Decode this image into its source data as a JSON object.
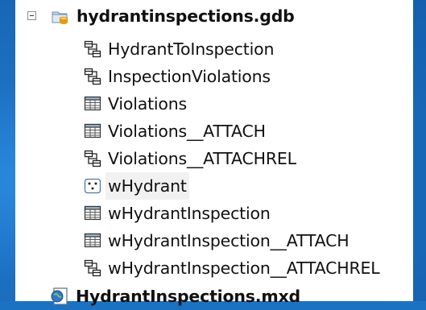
{
  "tree": {
    "geodatabase": {
      "label": "hydrantinspections.gdb",
      "icon": "geodatabase-icon",
      "expanded": true,
      "children": [
        {
          "label": "HydrantToInspection",
          "icon": "relationship-class-icon"
        },
        {
          "label": "InspectionViolations",
          "icon": "relationship-class-icon"
        },
        {
          "label": "Violations",
          "icon": "table-icon"
        },
        {
          "label": "Violations__ATTACH",
          "icon": "table-icon"
        },
        {
          "label": "Violations__ATTACHREL",
          "icon": "relationship-class-icon"
        },
        {
          "label": "wHydrant",
          "icon": "point-feature-class-icon",
          "selected": true
        },
        {
          "label": "wHydrantInspection",
          "icon": "table-icon"
        },
        {
          "label": "wHydrantInspection__ATTACH",
          "icon": "table-icon"
        },
        {
          "label": "wHydrantInspection__ATTACHREL",
          "icon": "relationship-class-icon"
        }
      ]
    },
    "map_document": {
      "label": "HydrantInspections.mxd",
      "icon": "map-document-icon"
    }
  },
  "colors": {
    "desktop_background": "#1c72c2",
    "panel_background": "#ffffff",
    "selection": "#f1f1f1"
  }
}
